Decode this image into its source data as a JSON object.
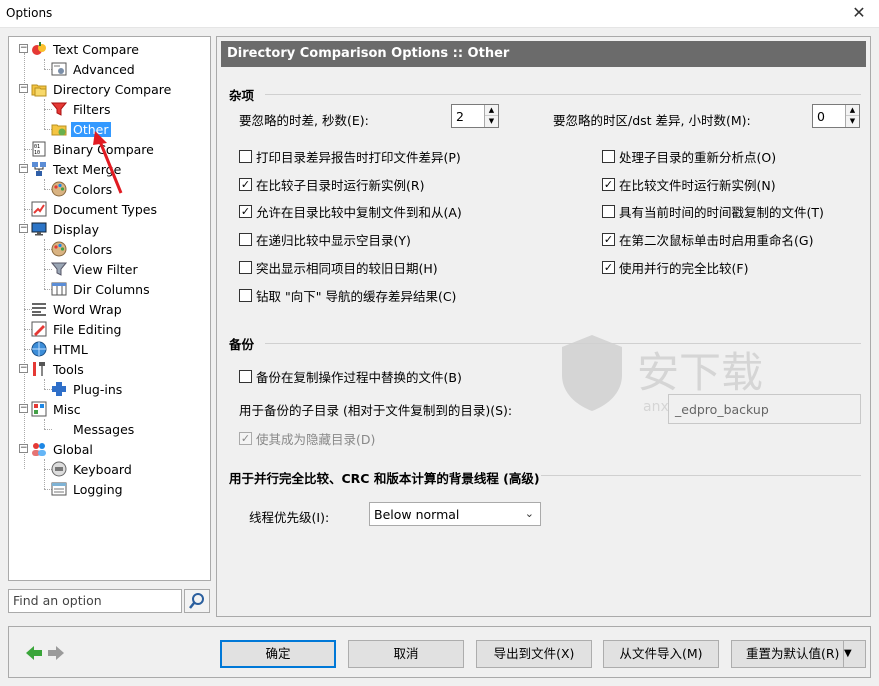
{
  "window": {
    "title": "Options",
    "close_glyph": "✕"
  },
  "tree": {
    "items": [
      {
        "label": "Text Compare",
        "icon": "text-compare-icon"
      },
      {
        "label": "Advanced",
        "icon": "advanced-icon"
      },
      {
        "label": "Directory Compare",
        "icon": "directory-compare-icon"
      },
      {
        "label": "Filters",
        "icon": "filter-icon"
      },
      {
        "label": "Other",
        "icon": "folder-other-icon"
      },
      {
        "label": "Binary Compare",
        "icon": "binary-compare-icon"
      },
      {
        "label": "Text Merge",
        "icon": "text-merge-icon"
      },
      {
        "label": "Colors",
        "icon": "colors-icon"
      },
      {
        "label": "Document Types",
        "icon": "document-types-icon"
      },
      {
        "label": "Display",
        "icon": "display-icon"
      },
      {
        "label": "Colors",
        "icon": "colors-icon"
      },
      {
        "label": "View Filter",
        "icon": "filter-icon"
      },
      {
        "label": "Dir Columns",
        "icon": "dir-columns-icon"
      },
      {
        "label": "Word Wrap",
        "icon": "word-wrap-icon"
      },
      {
        "label": "File Editing",
        "icon": "file-editing-icon"
      },
      {
        "label": "HTML",
        "icon": "html-icon"
      },
      {
        "label": "Tools",
        "icon": "tools-icon"
      },
      {
        "label": "Plug-ins",
        "icon": "plugins-icon"
      },
      {
        "label": "Misc",
        "icon": "misc-icon"
      },
      {
        "label": "Messages",
        "icon": "messages-icon"
      },
      {
        "label": "Global",
        "icon": "global-icon"
      },
      {
        "label": "Keyboard",
        "icon": "keyboard-icon"
      },
      {
        "label": "Logging",
        "icon": "logging-icon"
      }
    ],
    "selected": "Other",
    "search_placeholder": "Find an option"
  },
  "panel": {
    "header": "Directory Comparison Options :: Other",
    "misc": {
      "title": "杂项",
      "time_diff_label": "要忽略的时差, 秒数(E):",
      "time_diff_value": "2",
      "tz_label": "要忽略的时区/dst 差异, 小时数(M):",
      "tz_value": "0",
      "checks_left": [
        {
          "label": "打印目录差异报告时打印文件差异(P)",
          "checked": ""
        },
        {
          "label": "在比较子目录时运行新实例(R)",
          "checked": "✓"
        },
        {
          "label": "允许在目录比较中复制文件到和从(A)",
          "checked": "✓"
        },
        {
          "label": "在递归比较中显示空目录(Y)",
          "checked": ""
        },
        {
          "label": "突出显示相同项目的较旧日期(H)",
          "checked": ""
        },
        {
          "label": "钻取 \"向下\" 导航的缓存差异结果(C)",
          "checked": ""
        }
      ],
      "checks_right": [
        {
          "label": "处理子目录的重新分析点(O)",
          "checked": ""
        },
        {
          "label": "在比较文件时运行新实例(N)",
          "checked": "✓"
        },
        {
          "label": "具有当前时间的时间戳复制的文件(T)",
          "checked": ""
        },
        {
          "label": "在第二次鼠标单击时启用重命名(G)",
          "checked": "✓"
        },
        {
          "label": "使用并行的完全比较(F)",
          "checked": "✓"
        }
      ]
    },
    "backup": {
      "title": "备份",
      "backup_check": {
        "label": "备份在复制操作过程中替换的文件(B)",
        "checked": ""
      },
      "subdir_label": "用于备份的子目录 (相对于文件复制到的目录)(S):",
      "subdir_value": "_edpro_backup",
      "hidden_check": {
        "label": "使其成为隐藏目录(D)",
        "checked": "✓"
      }
    },
    "thread": {
      "title": "用于并行完全比较、CRC 和版本计算的背景线程 (高级)",
      "priority_label": "线程优先级(I):",
      "priority_value": "Below normal"
    }
  },
  "buttons": {
    "ok": "确定",
    "cancel": "取消",
    "export": "导出到文件(X)",
    "import": "从文件导入(M)",
    "reset": "重置为默认值(R)",
    "dropdown_glyph": "▼"
  },
  "watermark": {
    "text": "安下载",
    "sub": "anxz.com"
  },
  "colors": {
    "accent": "#3399ff",
    "header_bg": "#6b6b6b",
    "arrow_red": "#e11b22",
    "nav_green": "#3aa53a"
  }
}
